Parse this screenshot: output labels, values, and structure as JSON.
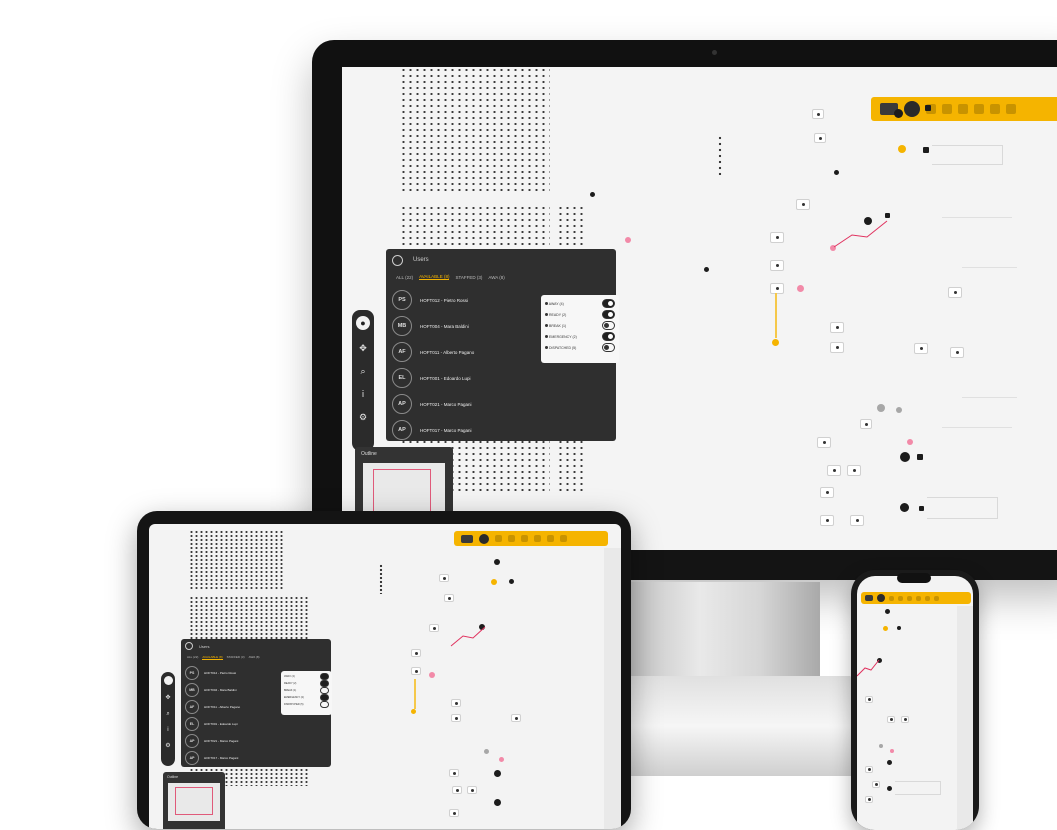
{
  "panel": {
    "title": "Users",
    "tabs": [
      "ALL (22)",
      "AVAILABLE (8)",
      "STAFFED (3)",
      "AWA (8)"
    ],
    "users": [
      {
        "initials": "PS",
        "name": "HOFT012 - Pietro Rossi"
      },
      {
        "initials": "MB",
        "name": "HOFT004 - Mara Baldini"
      },
      {
        "initials": "AF",
        "name": "HOFT011 - Alberto Pagano"
      },
      {
        "initials": "EL",
        "name": "HOFT001 - Edoardo Lupi"
      },
      {
        "initials": "AP",
        "name": "HOFT021 - Marco Pagani"
      },
      {
        "initials": "AP",
        "name": "HOFT017 - Marco Pagani"
      }
    ],
    "status_filters": [
      {
        "label": "AWAY (4)",
        "on": true
      },
      {
        "label": "READY (2)",
        "on": true
      },
      {
        "label": "BREAK (1)",
        "on": false
      },
      {
        "label": "EMERGENCY (2)",
        "on": true
      },
      {
        "label": "DISPATCHED (5)",
        "on": false
      }
    ]
  },
  "outline": {
    "title": "Outline"
  },
  "toolbar": {
    "icons": [
      "layers-icon",
      "target-icon",
      "grid-icon",
      "ruler-icon",
      "node-icon",
      "filter-icon",
      "link-icon",
      "user-icon"
    ]
  },
  "side_tools": {
    "icons": [
      "bulb-icon",
      "move-icon",
      "zoom-icon",
      "info-icon",
      "settings-icon"
    ]
  },
  "colors": {
    "accent": "#f5b400",
    "highlight": "#f28aa8",
    "panel": "#2f2f2f"
  }
}
